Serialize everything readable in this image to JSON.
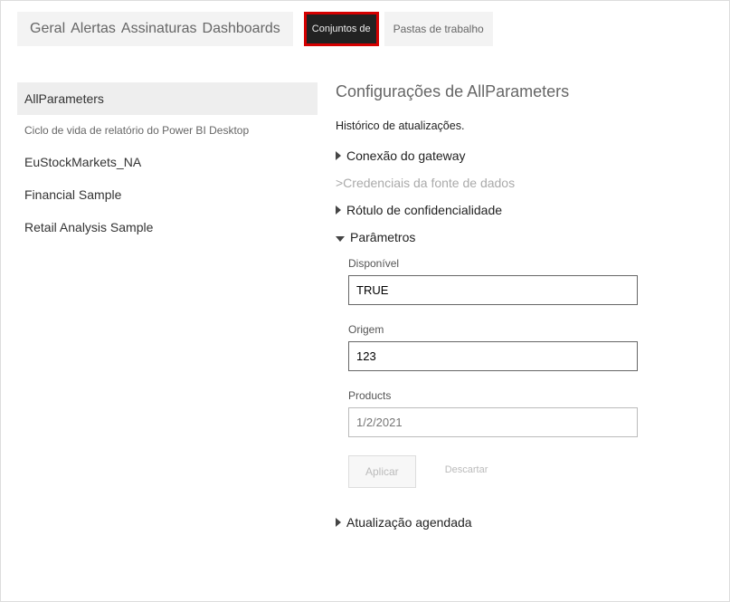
{
  "topTabs": {
    "geral": "Geral",
    "alertas": "Alertas",
    "assinaturas": "Assinaturas",
    "dashboards": "Dashboards",
    "conjuntos": "Conjuntos de",
    "pastas": "Pastas de trabalho"
  },
  "sidebar": [
    {
      "label": "AllParameters",
      "selected": true
    },
    {
      "label": "Ciclo de vida de relatório do Power BI Desktop",
      "small": true
    },
    {
      "label": "EuStockMarkets_NA"
    },
    {
      "label": "Financial Sample"
    },
    {
      "label": "Retail Analysis Sample"
    }
  ],
  "main": {
    "title": "Configurações de AllParameters",
    "history": "Histórico de atualizações.",
    "sections": {
      "gateway": "Conexão do gateway",
      "credentials": ">Credenciais da fonte de dados",
      "sensitivity": "Rótulo de confidencialidade",
      "parameters": "Parâmetros",
      "scheduled": "Atualização agendada"
    },
    "params": [
      {
        "label": "Disponível",
        "value": "TRUE",
        "grey": false
      },
      {
        "label": "Origem",
        "value": "123",
        "grey": false
      },
      {
        "label": "Products",
        "value": "1/2/2021",
        "grey": true
      }
    ],
    "buttons": {
      "apply": "Aplicar",
      "discard": "Descartar"
    }
  }
}
